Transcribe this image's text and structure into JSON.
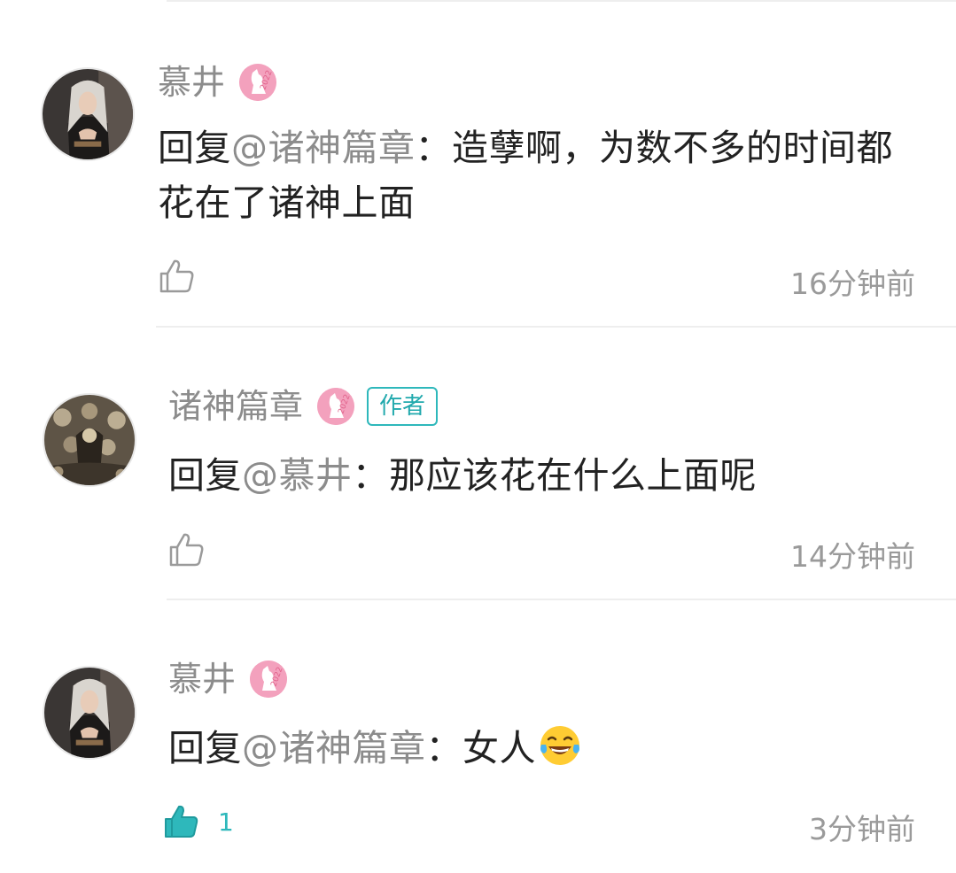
{
  "comments": [
    {
      "author": "慕井",
      "badge": "2022",
      "is_author": false,
      "author_tag": "",
      "reply_prefix": "回复",
      "mention": "@诸神篇章",
      "text_line1": "：造孽啊，为数不多的时间都",
      "text_line2": "花在了诸神上面",
      "likes": "",
      "liked": false,
      "time": "16分钟前"
    },
    {
      "author": "诸神篇章",
      "badge": "2022",
      "is_author": true,
      "author_tag": "作者",
      "reply_prefix": "回复",
      "mention": "@慕井",
      "text_line1": "：那应该花在什么上面呢",
      "likes": "",
      "liked": false,
      "time": "14分钟前"
    },
    {
      "author": "慕井",
      "badge": "2022",
      "is_author": false,
      "author_tag": "",
      "reply_prefix": "回复",
      "mention": "@诸神篇章",
      "text_line1": "：女人",
      "emoji": "laughing-with-tears-emoji",
      "likes": "1",
      "liked": true,
      "time": "3分钟前"
    }
  ],
  "colors": {
    "accent": "#2eb8bb",
    "name_gray": "#8c8c8c",
    "text": "#222222",
    "badge_pink": "#f3a1bd"
  }
}
